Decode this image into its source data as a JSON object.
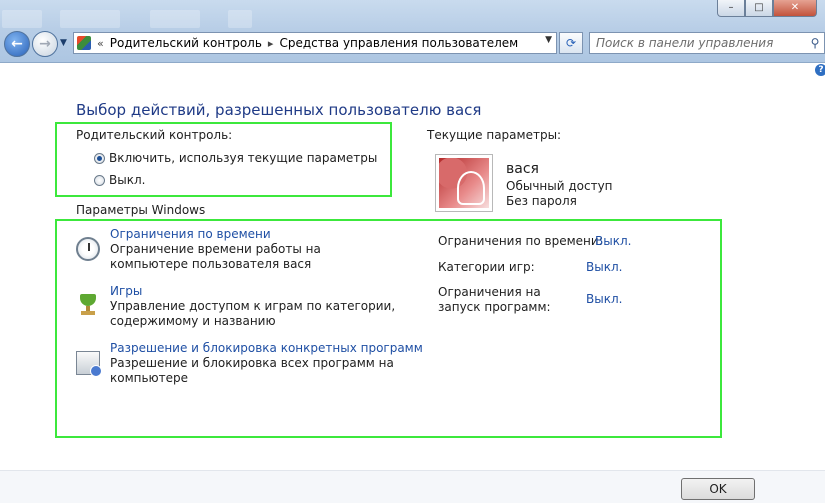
{
  "window": {
    "controls": [
      "–",
      "□",
      "✕"
    ]
  },
  "nav": {
    "breadcrumb_prefix": "«",
    "breadcrumb": [
      "Родительский контроль",
      "Средства управления пользователем"
    ],
    "breadcrumb_sep": "▸",
    "search_placeholder": "Поиск в панели управления",
    "icons": {
      "back": "back-arrow-icon",
      "forward": "forward-arrow-icon",
      "refresh": "refresh-icon",
      "search": "search-icon",
      "help": "help-icon"
    }
  },
  "page": {
    "title": "Выбор действий, разрешенных пользователю вася",
    "parental_control": {
      "label": "Родительский контроль:",
      "options": [
        {
          "label": "Включить, используя текущие параметры",
          "selected": true
        },
        {
          "label": "Выкл.",
          "selected": false
        }
      ]
    },
    "windows_settings": {
      "label": "Параметры Windows",
      "items": [
        {
          "link": "Ограничения по времени",
          "description": "Ограничение времени работы на компьютере пользователя вася",
          "icon": "clock-icon"
        },
        {
          "link": "Игры",
          "description": "Управление доступом к играм по категории, содержимому и названию",
          "icon": "games-trophy-icon"
        },
        {
          "link": "Разрешение и блокировка конкретных программ",
          "description": "Разрешение и блокировка всех программ на компьютере",
          "icon": "programs-icon"
        }
      ]
    },
    "current_settings": {
      "label": "Текущие параметры:",
      "user": {
        "name": "вася",
        "account_type": "Обычный доступ",
        "password": "Без пароля"
      },
      "status": [
        {
          "label": "Ограничения по времени:",
          "value": "Выкл."
        },
        {
          "label": "Категории игр:",
          "value": "Выкл."
        },
        {
          "label": "Ограничения на запуск программ:",
          "value": "Выкл."
        }
      ]
    },
    "ok_label": "OK"
  },
  "colors": {
    "highlight": "#3ce83c",
    "link": "#1f4fa4",
    "title": "#1f3a86"
  }
}
